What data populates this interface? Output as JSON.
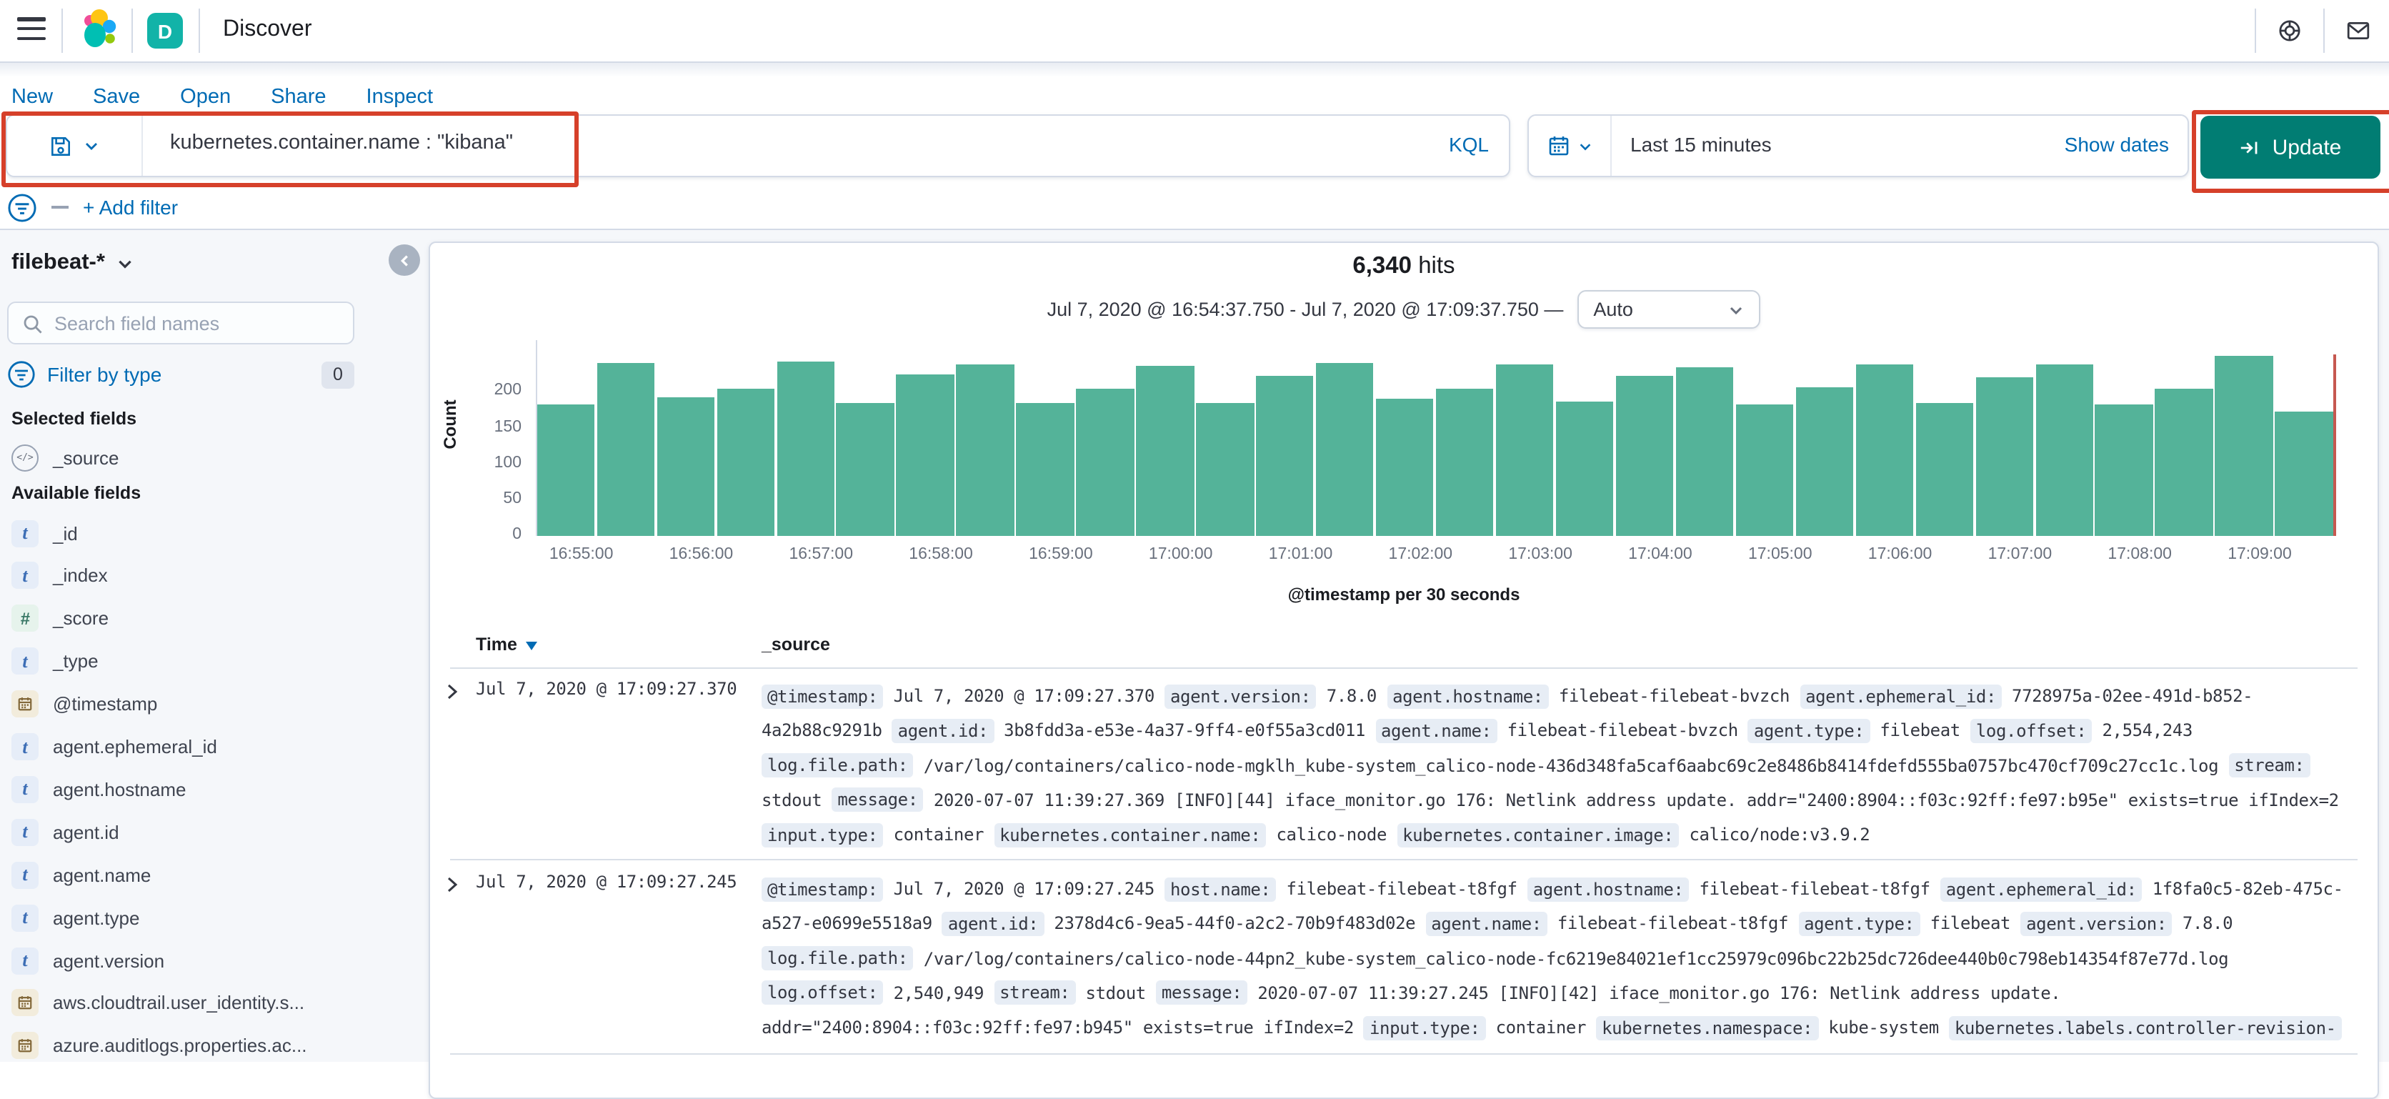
{
  "topbar": {
    "title": "Discover",
    "space_initial": "D"
  },
  "nav_links": [
    "New",
    "Save",
    "Open",
    "Share",
    "Inspect"
  ],
  "query_bar": {
    "query": "kubernetes.container.name : \"kibana\"",
    "language": "KQL",
    "time_range": "Last 15 minutes",
    "show_dates_label": "Show dates",
    "update_label": "Update"
  },
  "filter_bar": {
    "add_filter_label": "+ Add filter"
  },
  "sidebar": {
    "index_pattern": "filebeat-*",
    "search_placeholder": "Search field names",
    "filter_by_type_label": "Filter by type",
    "filter_count": "0",
    "selected_heading": "Selected fields",
    "selected_fields": [
      {
        "name": "_source",
        "type": "source"
      }
    ],
    "available_heading": "Available fields",
    "available_fields": [
      {
        "name": "_id",
        "type": "string"
      },
      {
        "name": "_index",
        "type": "string"
      },
      {
        "name": "_score",
        "type": "number"
      },
      {
        "name": "_type",
        "type": "string"
      },
      {
        "name": "@timestamp",
        "type": "date"
      },
      {
        "name": "agent.ephemeral_id",
        "type": "string"
      },
      {
        "name": "agent.hostname",
        "type": "string"
      },
      {
        "name": "agent.id",
        "type": "string"
      },
      {
        "name": "agent.name",
        "type": "string"
      },
      {
        "name": "agent.type",
        "type": "string"
      },
      {
        "name": "agent.version",
        "type": "string"
      },
      {
        "name": "aws.cloudtrail.user_identity.s...",
        "type": "date"
      },
      {
        "name": "azure.auditlogs.properties.ac...",
        "type": "date"
      }
    ]
  },
  "results_header": {
    "hits_count": "6,340",
    "hits_label": "hits",
    "range_text": "Jul 7, 2020 @ 16:54:37.750 - Jul 7, 2020 @ 17:09:37.750 —",
    "interval_value": "Auto"
  },
  "chart_data": {
    "type": "bar",
    "title": "6,340 hits",
    "xlabel": "@timestamp per 30 seconds",
    "ylabel": "Count",
    "ylim": [
      0,
      250
    ],
    "y_ticks": [
      0,
      50,
      100,
      150,
      200
    ],
    "x_start": "16:54:37.750",
    "x_end": "17:09:37.750",
    "bucket_interval": "30 seconds",
    "x_tick_labels": [
      "16:55:00",
      "16:56:00",
      "16:57:00",
      "16:58:00",
      "16:59:00",
      "17:00:00",
      "17:01:00",
      "17:02:00",
      "17:03:00",
      "17:04:00",
      "17:05:00",
      "17:06:00",
      "17:07:00",
      "17:08:00",
      "17:09:00"
    ],
    "values": [
      183,
      240,
      192,
      205,
      243,
      185,
      225,
      238,
      185,
      205,
      237,
      185,
      223,
      240,
      190,
      205,
      238,
      187,
      223,
      235,
      183,
      206,
      238,
      185,
      221,
      238,
      183,
      205,
      250,
      172
    ],
    "bar_color": "#54B399",
    "now_marker_color": "#C65850",
    "grid": false,
    "legend": "none"
  },
  "doc_table": {
    "col_time": "Time",
    "col_source": "_source",
    "rows": [
      {
        "time": "Jul 7, 2020 @ 17:09:27.370",
        "fields": [
          {
            "k": "@timestamp:",
            "v": "Jul 7, 2020 @ 17:09:27.370"
          },
          {
            "k": "agent.version:",
            "v": "7.8.0"
          },
          {
            "k": "agent.hostname:",
            "v": "filebeat-filebeat-bvzch"
          },
          {
            "k": "agent.ephemeral_id:",
            "v": "7728975a-02ee-491d-b852-4a2b88c9291b"
          },
          {
            "k": "agent.id:",
            "v": "3b8fdd3a-e53e-4a37-9ff4-e0f55a3cd011"
          },
          {
            "k": "agent.name:",
            "v": "filebeat-filebeat-bvzch"
          },
          {
            "k": "agent.type:",
            "v": "filebeat"
          },
          {
            "k": "log.offset:",
            "v": "2,554,243"
          },
          {
            "k": "log.file.path:",
            "v": "/var/log/containers/calico-node-mgklh_kube-system_calico-node-436d348fa5caf6aabc69c2e8486b8414fdefd555ba0757bc470cf709c27cc1c.log"
          },
          {
            "k": "stream:",
            "v": "stdout"
          },
          {
            "k": "message:",
            "v": "2020-07-07 11:39:27.369 [INFO][44] iface_monitor.go 176: Netlink address update. addr=\"2400:8904::f03c:92ff:fe97:b95e\" exists=true ifIndex=2"
          },
          {
            "k": "input.type:",
            "v": "container"
          },
          {
            "k": "kubernetes.container.name:",
            "v": "calico-node"
          },
          {
            "k": "kubernetes.container.image:",
            "v": "calico/node:v3.9.2"
          }
        ]
      },
      {
        "time": "Jul 7, 2020 @ 17:09:27.245",
        "fields": [
          {
            "k": "@timestamp:",
            "v": "Jul 7, 2020 @ 17:09:27.245"
          },
          {
            "k": "host.name:",
            "v": "filebeat-filebeat-t8fgf"
          },
          {
            "k": "agent.hostname:",
            "v": "filebeat-filebeat-t8fgf"
          },
          {
            "k": "agent.ephemeral_id:",
            "v": "1f8fa0c5-82eb-475c-a527-e0699e5518a9"
          },
          {
            "k": "agent.id:",
            "v": "2378d4c6-9ea5-44f0-a2c2-70b9f483d02e"
          },
          {
            "k": "agent.name:",
            "v": "filebeat-filebeat-t8fgf"
          },
          {
            "k": "agent.type:",
            "v": "filebeat"
          },
          {
            "k": "agent.version:",
            "v": "7.8.0"
          },
          {
            "k": "log.file.path:",
            "v": "/var/log/containers/calico-node-44pn2_kube-system_calico-node-fc6219e84021ef1cc25979c096bc22b25dc726dee440b0c798eb14354f87e77d.log"
          },
          {
            "k": "log.offset:",
            "v": "2,540,949"
          },
          {
            "k": "stream:",
            "v": "stdout"
          },
          {
            "k": "message:",
            "v": "2020-07-07 11:39:27.245 [INFO][42] iface_monitor.go 176: Netlink address update. addr=\"2400:8904::f03c:92ff:fe97:b945\" exists=true ifIndex=2"
          },
          {
            "k": "input.type:",
            "v": "container"
          },
          {
            "k": "kubernetes.namespace:",
            "v": "kube-system"
          },
          {
            "k": "kubernetes.labels.controller-revision-",
            "v": null
          }
        ]
      }
    ]
  },
  "colors": {
    "primary_blue": "#006BB4",
    "annotation_red": "#D6402A",
    "update_button_teal": "#017D73",
    "space_badge_teal": "#12B3A8",
    "bar_green": "#54B399",
    "now_marker_red": "#C65850",
    "page_background": "#F5F7FA"
  }
}
